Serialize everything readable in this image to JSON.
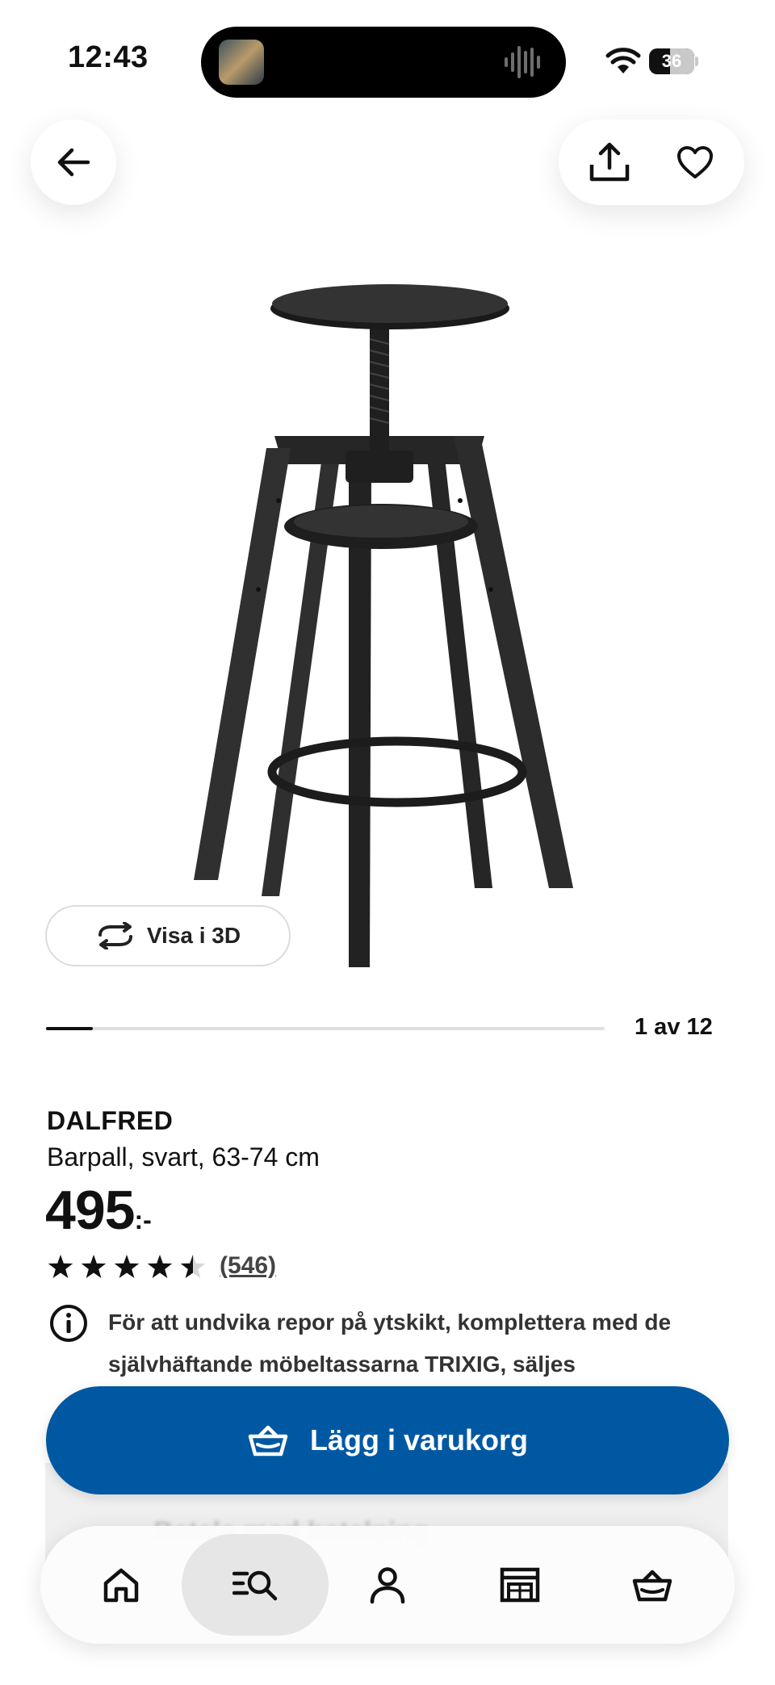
{
  "status_bar": {
    "time": "12:43",
    "battery": "36",
    "battery_level": 0.36
  },
  "gallery": {
    "counter": "1 av 12",
    "current": 1,
    "total": 12,
    "view_3d_label": "Visa i 3D"
  },
  "product": {
    "name": "DALFRED",
    "description": "Barpall, svart, 63-74 cm",
    "price": "495",
    "price_suffix": ":-",
    "rating": 4.5,
    "rating_max": 5,
    "review_count": "(546)",
    "info_note": "För att undvika repor på ytskikt, komplettera med de självhäftande möbeltassarna TRIXIG, säljes"
  },
  "cart": {
    "add_label": "Lägg i varukorg"
  },
  "behind": {
    "line1": "Betala med betalning"
  },
  "colors": {
    "brand_blue": "#0058a3",
    "product_black": "#2b2b2b"
  },
  "tab_bar": {
    "items": [
      "home-icon",
      "search-icon",
      "profile-icon",
      "store-icon",
      "basket-icon"
    ],
    "active": "search-icon"
  }
}
